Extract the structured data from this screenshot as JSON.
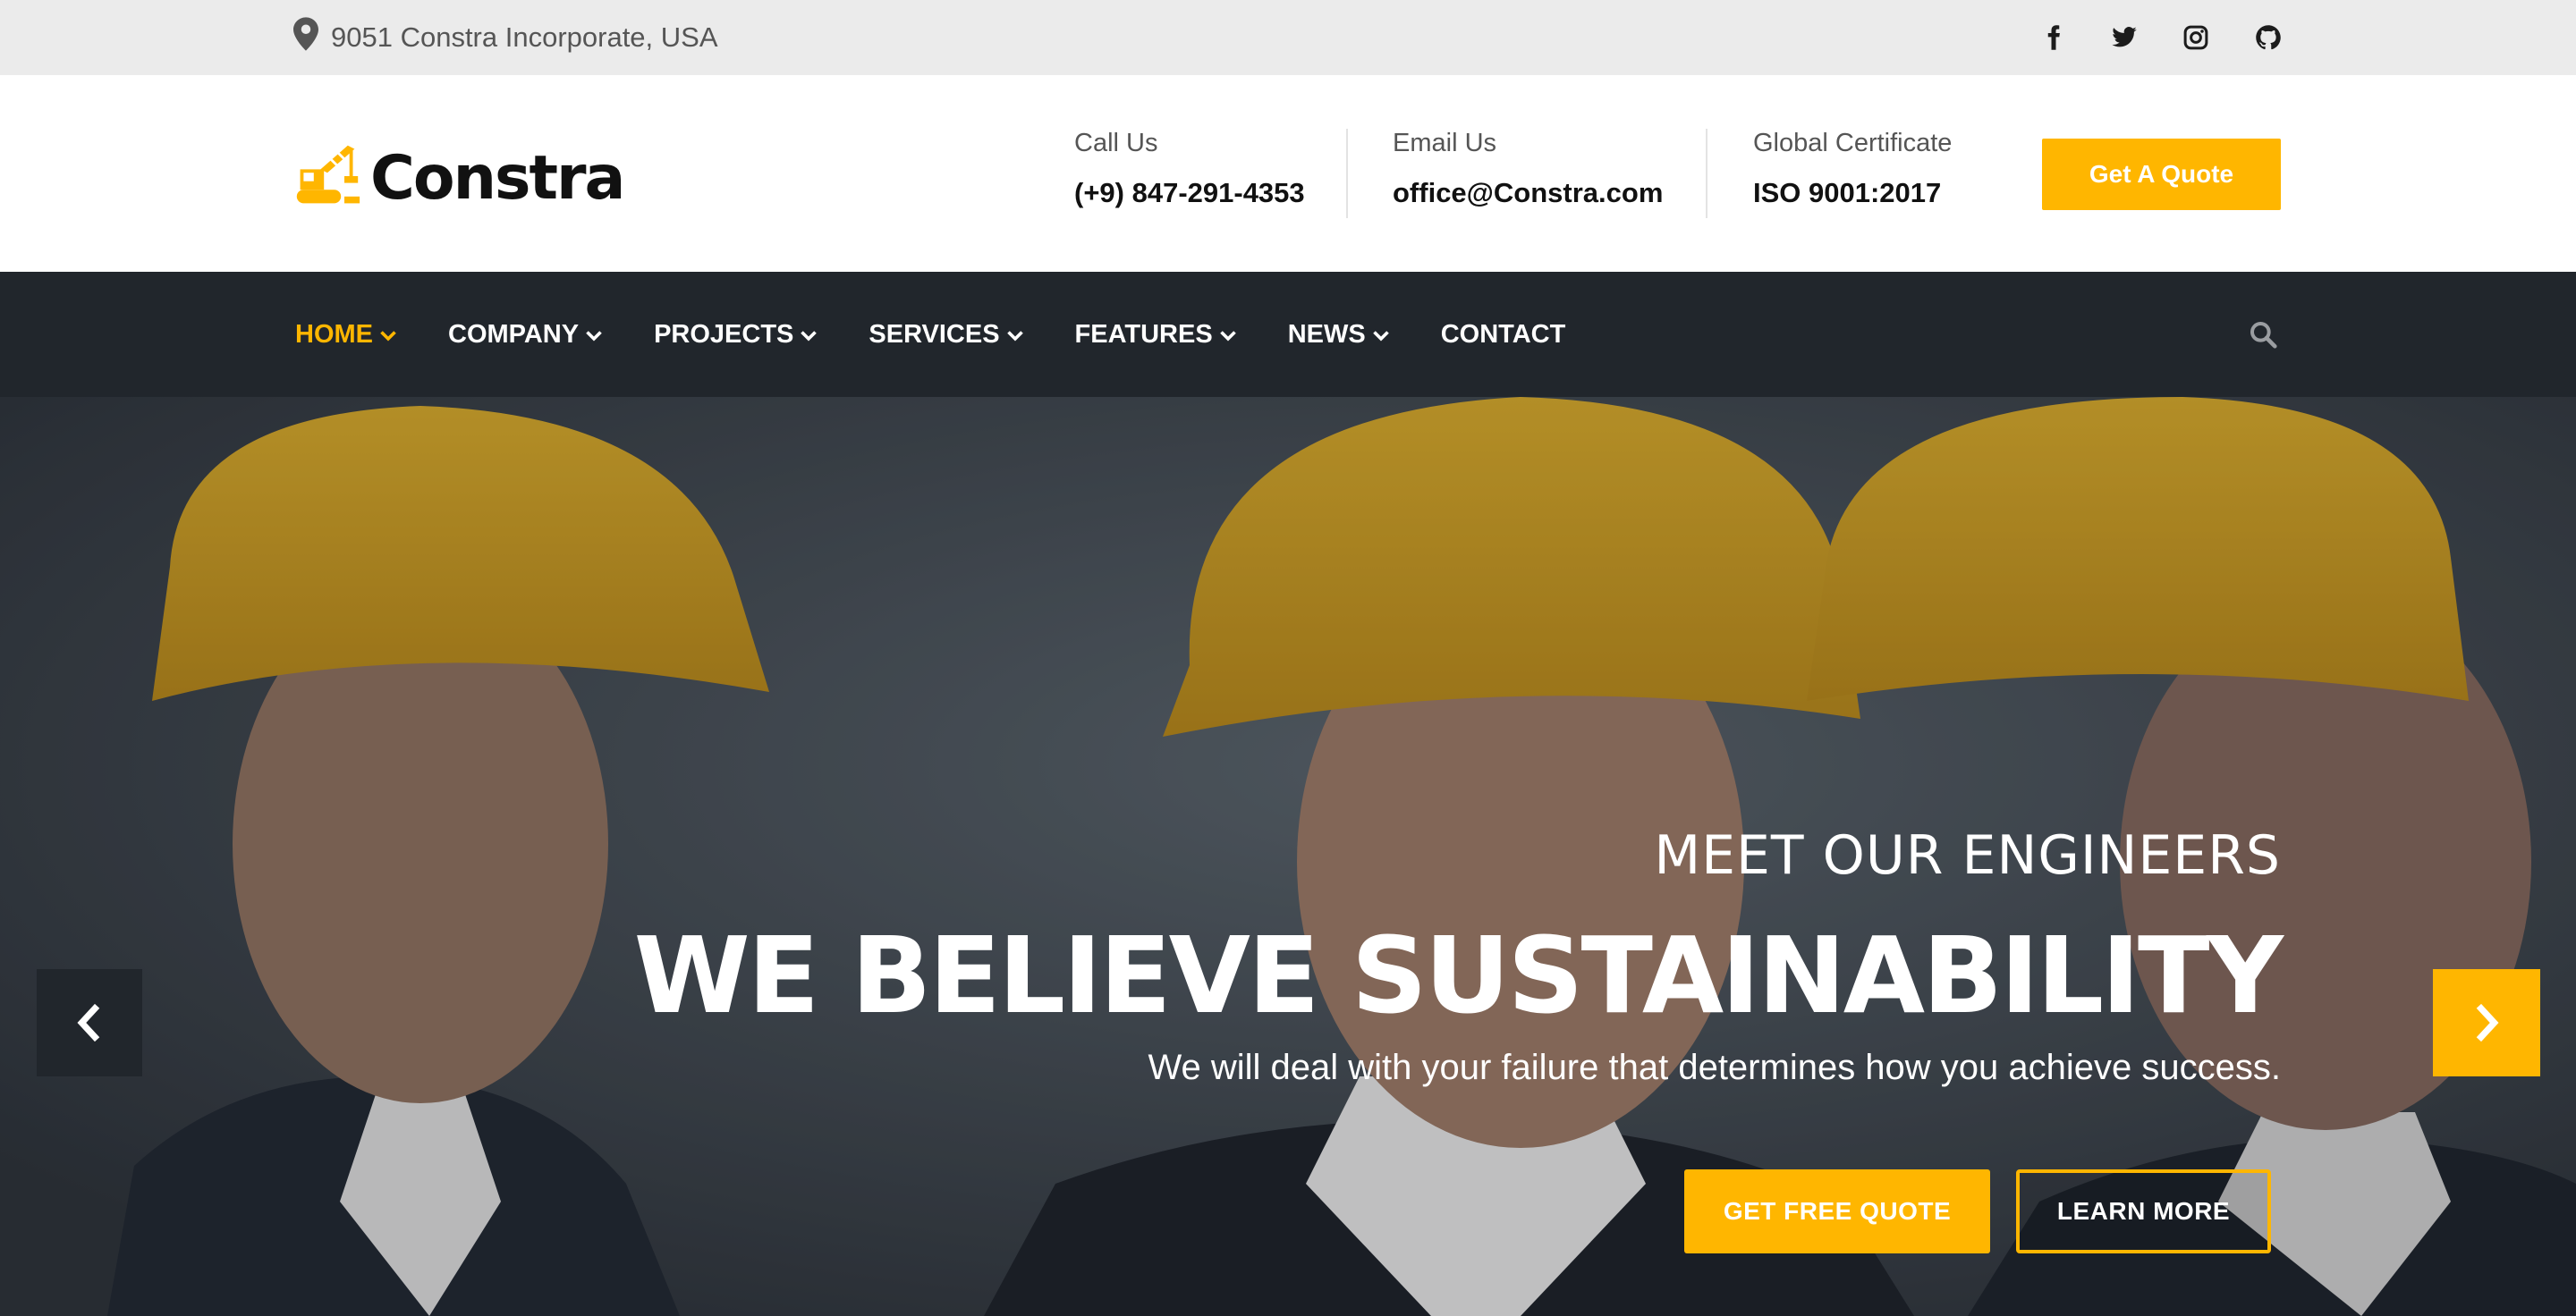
{
  "topbar": {
    "address": "9051 Constra Incorporate, USA",
    "social": [
      "facebook-icon",
      "twitter-icon",
      "instagram-icon",
      "github-icon"
    ]
  },
  "header": {
    "logo_text": "Constra",
    "call_label": "Call Us",
    "call_value": "(+9) 847-291-4353",
    "email_label": "Email Us",
    "email_value": "office@Constra.com",
    "cert_label": "Global Certificate",
    "cert_value": "ISO 9001:2017",
    "quote_button": "Get A Quote"
  },
  "nav": {
    "items": [
      {
        "label": "HOME",
        "dropdown": true,
        "active": true
      },
      {
        "label": "COMPANY",
        "dropdown": true
      },
      {
        "label": "PROJECTS",
        "dropdown": true
      },
      {
        "label": "SERVICES",
        "dropdown": true
      },
      {
        "label": "FEATURES",
        "dropdown": true
      },
      {
        "label": "NEWS",
        "dropdown": true
      },
      {
        "label": "CONTACT",
        "dropdown": false
      }
    ]
  },
  "hero": {
    "kicker": "MEET OUR ENGINEERS",
    "title": "WE BELIEVE SUSTAINABILITY",
    "subtitle": "We will deal with your failure that determines how you achieve success.",
    "primary_button": "GET FREE QUOTE",
    "secondary_button": "LEARN MORE"
  },
  "colors": {
    "accent": "#ffb600",
    "nav_bg": "#21262c",
    "topbar_bg": "#ebebeb"
  }
}
